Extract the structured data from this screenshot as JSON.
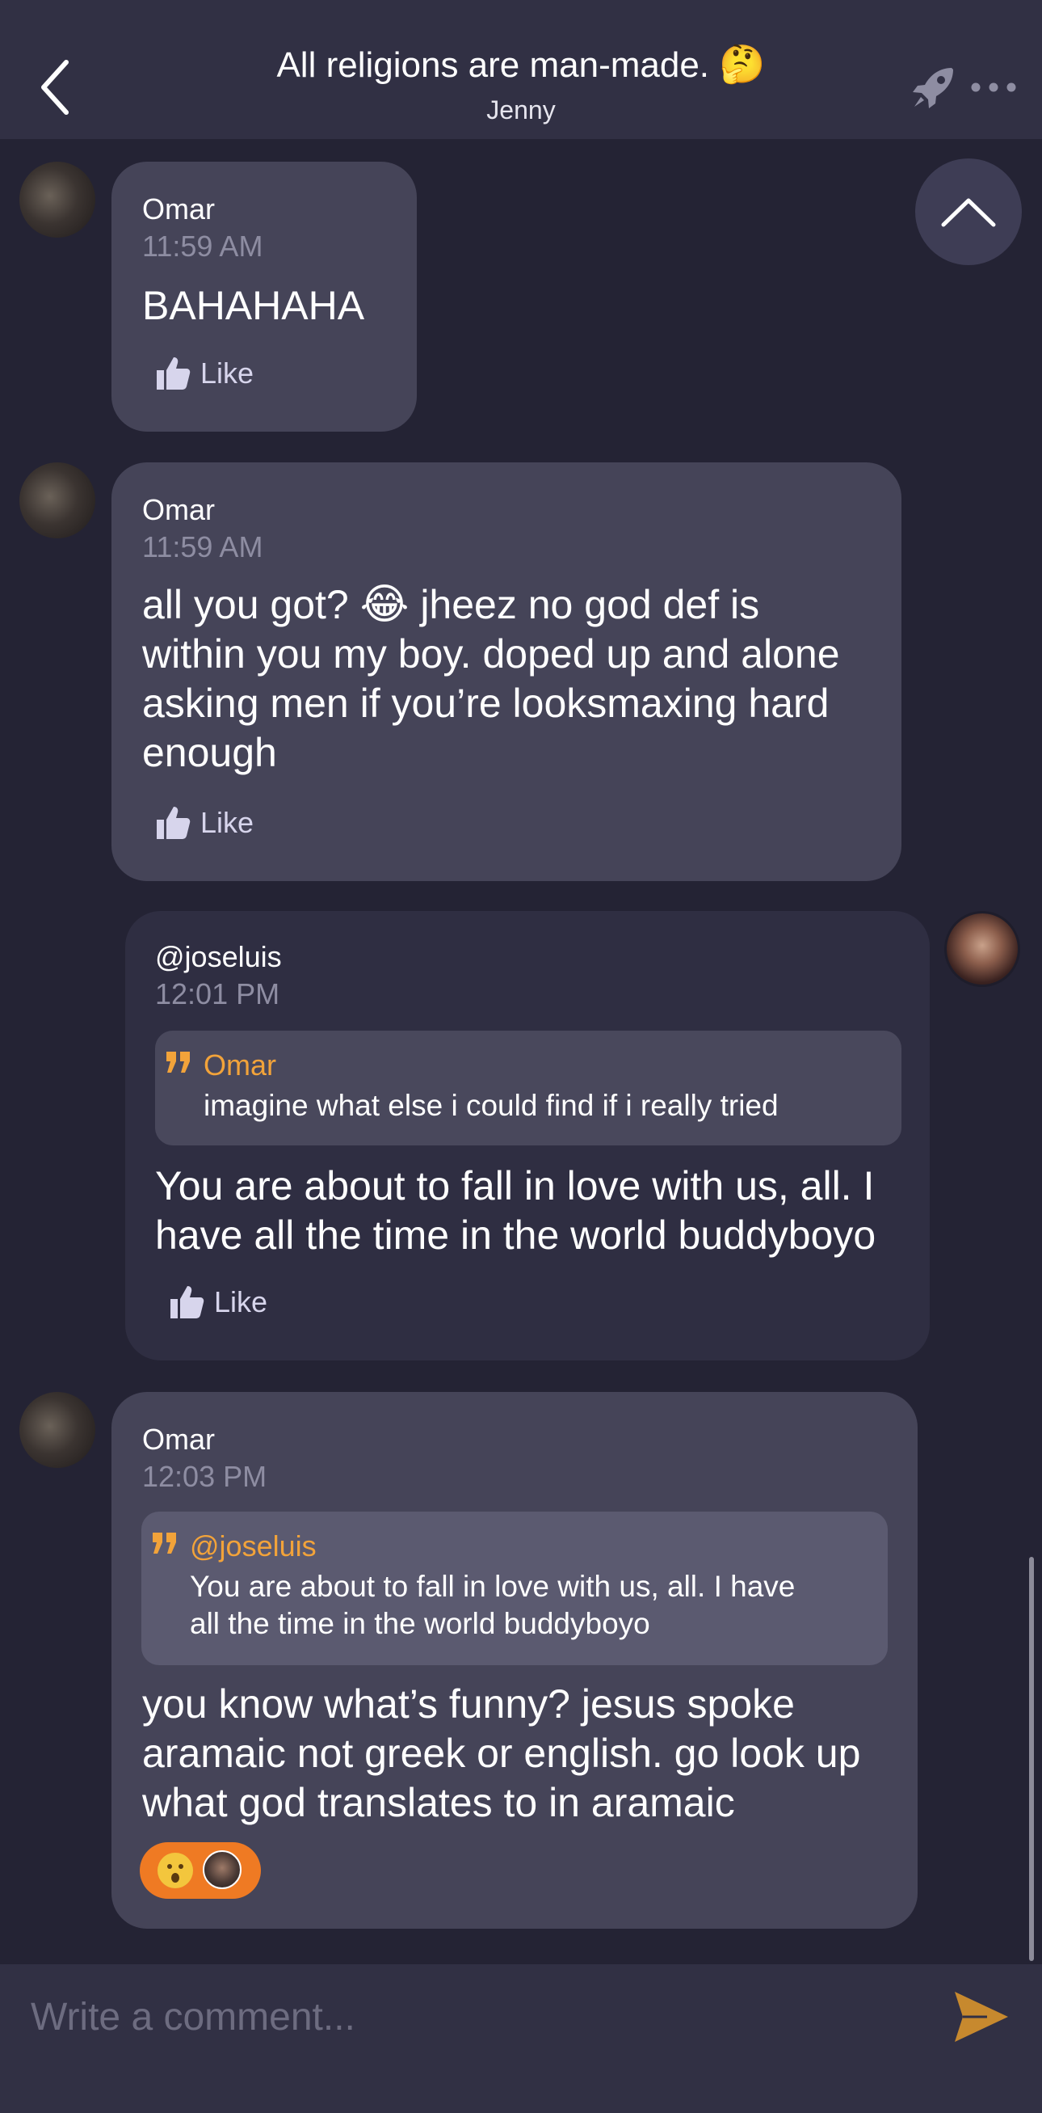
{
  "header": {
    "title": "All religions are man-made.",
    "title_emoji": "🤔",
    "subtitle": "Jenny"
  },
  "icons": {
    "back": "chevron-left-icon",
    "rocket": "rocket-icon",
    "more": "more-horizontal-icon",
    "scroll_up": "chevron-up-icon",
    "like": "thumbs-up-icon",
    "quote": "quote-icon",
    "send": "send-icon"
  },
  "messages": [
    {
      "sender": "Omar",
      "time": "11:59 AM",
      "text": "BAHAHAHA",
      "like_label": "Like"
    },
    {
      "sender": "Omar",
      "time": "11:59 AM",
      "text_lines": [
        "all you got?",
        "jheez no god def is",
        "within you my boy. doped up and alone",
        "asking men if you’re looksmaxing hard",
        "enough"
      ],
      "emoji": "😂",
      "like_label": "Like"
    },
    {
      "sender": "@joseluis",
      "time": "12:01 PM",
      "quote": {
        "name": "Omar",
        "text": "imagine what else i could find if i really tried"
      },
      "text_lines": [
        "You are about to fall in love with us, all. I",
        "have all the time in the world buddyboyo"
      ],
      "like_label": "Like"
    },
    {
      "sender": "Omar",
      "time": "12:03 PM",
      "quote": {
        "name": "@joseluis",
        "text_lines": [
          "You are about to fall in love with us, all. I have",
          "all the time in the world buddyboyo"
        ]
      },
      "text_lines": [
        "you know what’s funny? jesus spoke",
        "aramaic not greek or english. go look up",
        "what god translates to in aramaic"
      ],
      "reaction_emoji": "😮"
    }
  ],
  "composer": {
    "placeholder": "Write a comment..."
  },
  "colors": {
    "background": "#242334",
    "header": "#313044",
    "bubble_other": "#454458",
    "bubble_mine": "#2f2e42",
    "quote_name": "#f2a33a",
    "reaction": "#ef7a23",
    "send": "#c7892e"
  }
}
